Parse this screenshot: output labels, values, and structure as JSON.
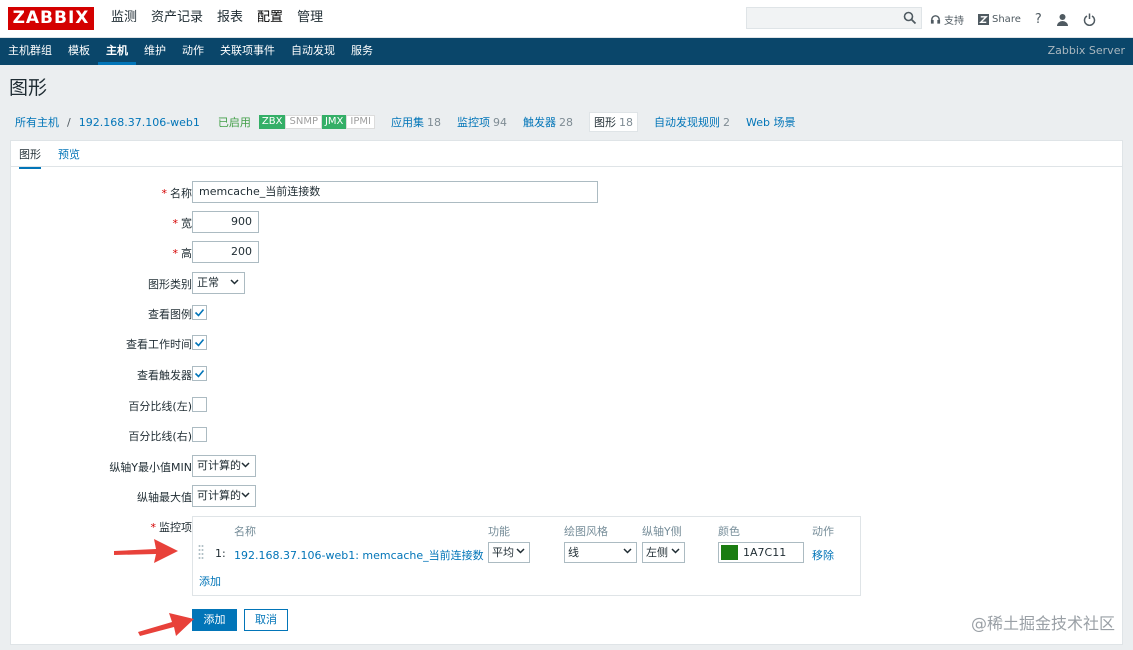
{
  "header": {
    "logo": "ZABBIX",
    "menu": [
      "监测",
      "资产记录",
      "报表",
      "配置",
      "管理"
    ],
    "support": "支持",
    "share": "Share",
    "help": "?"
  },
  "submenu": {
    "items": [
      "主机群组",
      "模板",
      "主机",
      "维护",
      "动作",
      "关联项事件",
      "自动发现",
      "服务"
    ],
    "server": "Zabbix Server"
  },
  "page": {
    "title": "图形"
  },
  "breadcrumb": {
    "all_hosts": "所有主机",
    "sep": "/",
    "host": "192.168.37.106-web1",
    "enabled": "已启用",
    "badges": [
      "ZBX",
      "SNMP",
      "JMX",
      "IPMI"
    ],
    "links": [
      {
        "label": "应用集",
        "count": "18"
      },
      {
        "label": "监控项",
        "count": "94"
      },
      {
        "label": "触发器",
        "count": "28"
      },
      {
        "label": "图形",
        "count": "18"
      },
      {
        "label": "自动发现规则",
        "count": "2"
      },
      {
        "label": "Web 场景",
        "count": ""
      }
    ]
  },
  "tabs": [
    "图形",
    "预览"
  ],
  "form": {
    "name_label": "名称",
    "name_value": "memcache_当前连接数",
    "width_label": "宽",
    "width_value": "900",
    "height_label": "高",
    "height_value": "200",
    "type_label": "图形类别",
    "type_value": "正常",
    "legend_label": "查看图例",
    "worktime_label": "查看工作时间",
    "triggers_label": "查看触发器",
    "pleft_label": "百分比线(左)",
    "pright_label": "百分比线(右)",
    "ymin_label": "纵轴Y最小值MIN",
    "ymin_value": "可计算的",
    "ymax_label": "纵轴最大值",
    "ymax_value": "可计算的",
    "items_label": "监控项"
  },
  "items_table": {
    "headers": [
      "名称",
      "功能",
      "绘图风格",
      "纵轴Y侧",
      "颜色",
      "动作"
    ],
    "rows": [
      {
        "num": "1:",
        "name": "192.168.37.106-web1: memcache_当前连接数",
        "function": "平均",
        "style": "线",
        "yside": "左侧",
        "color": "1A7C11",
        "action": "移除"
      }
    ],
    "add": "添加"
  },
  "buttons": {
    "add": "添加",
    "cancel": "取消"
  },
  "watermark": "@稀土掘金技术社区",
  "colors": {
    "accent": "#0275b8",
    "nav": "#0a466a",
    "logo": "#d40000",
    "swatch": "#1a7c11",
    "arrow": "#e8413a"
  }
}
